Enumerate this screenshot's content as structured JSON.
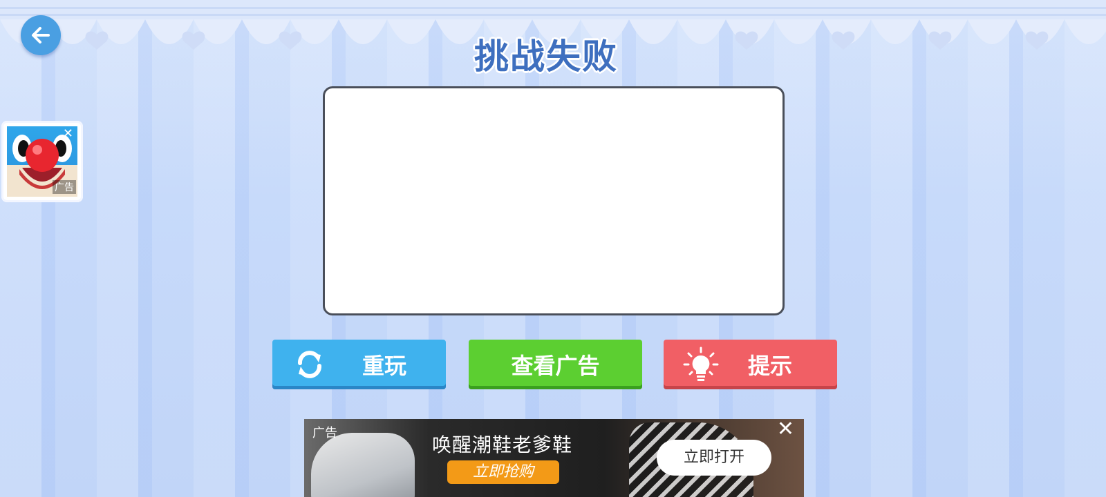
{
  "header": {
    "title": "挑战失败",
    "back_icon": "arrow-left-icon"
  },
  "side_ad": {
    "tag": "广告",
    "close_glyph": "✕"
  },
  "actions": {
    "replay_label": "重玩",
    "watch_ad_label": "查看广告",
    "hint_label": "提示"
  },
  "banner_ad": {
    "tag": "广告",
    "headline": "唤醒潮鞋老爹鞋",
    "buy_label": "立即抢购",
    "open_label": "立即打开",
    "close_glyph": "✕"
  },
  "colors": {
    "replay": "#3fb2ee",
    "watch_ad": "#5ccf31",
    "hint": "#f15f65",
    "title": "#3e6fbf",
    "back": "#4a9fe2"
  }
}
